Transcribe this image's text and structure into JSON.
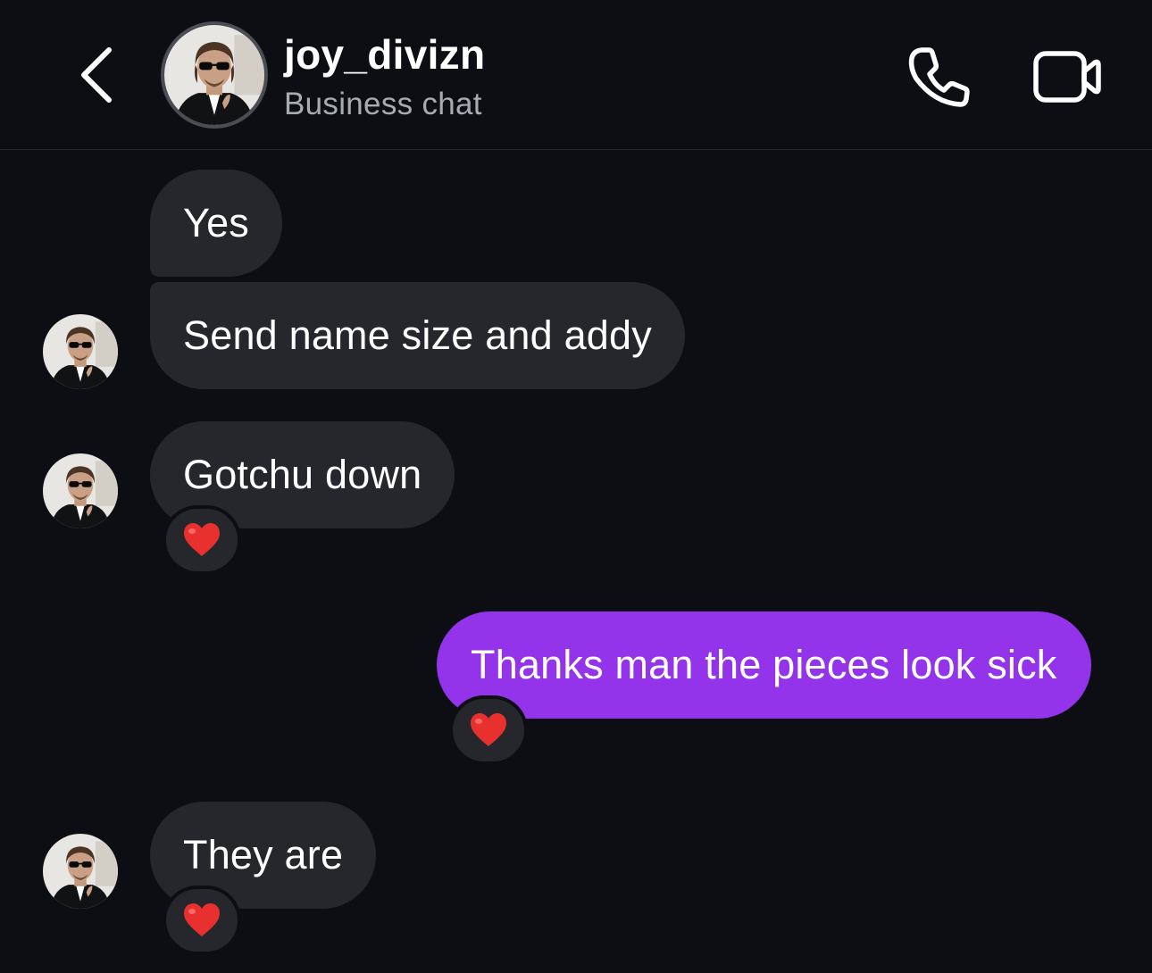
{
  "header": {
    "username": "joy_divizn",
    "subtitle": "Business chat",
    "back_icon": "chevron-left-icon",
    "call_icon": "phone-icon",
    "video_icon": "video-camera-icon"
  },
  "messages": [
    {
      "direction": "incoming",
      "text": "Yes"
    },
    {
      "direction": "incoming",
      "text": "Send name size and addy"
    },
    {
      "direction": "incoming",
      "text": "Gotchu down",
      "reaction": "heart"
    },
    {
      "direction": "outgoing",
      "text": "Thanks man the pieces look sick",
      "reaction": "heart"
    },
    {
      "direction": "incoming",
      "text": "They are",
      "reaction": "heart"
    }
  ],
  "colors": {
    "background": "#0c0e13",
    "incoming_bubble": "#25272c",
    "outgoing_bubble": "#9333ea",
    "subtitle": "#a8abb2",
    "heart": "#e8302e"
  }
}
